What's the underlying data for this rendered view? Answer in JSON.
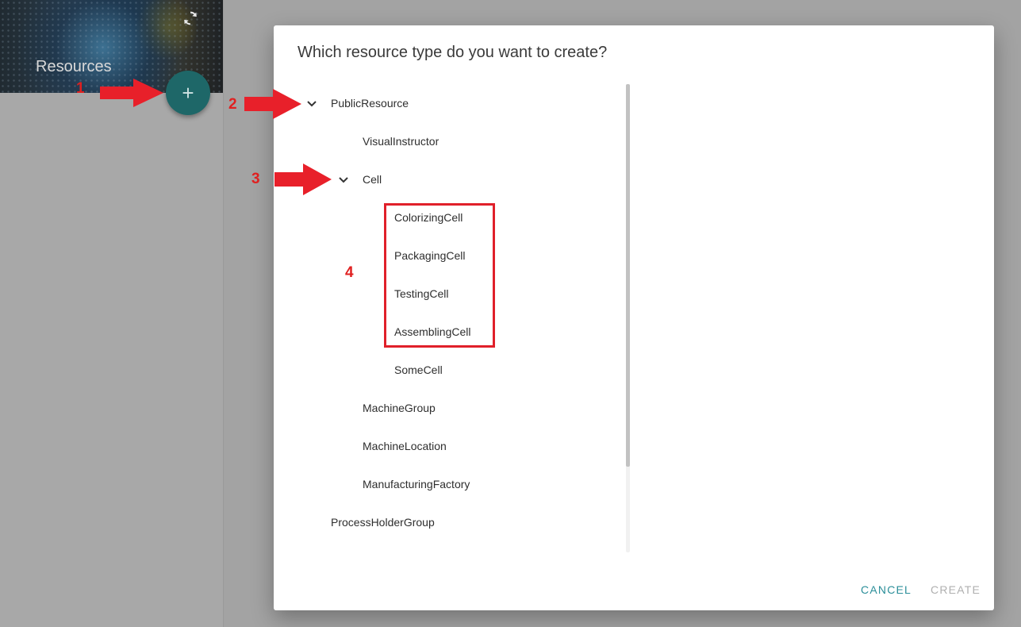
{
  "sidebar": {
    "title": "Resources",
    "fab_label": "+",
    "refresh_icon": "refresh-icon",
    "add_icon": "plus-icon"
  },
  "dialog": {
    "title": "Which resource type do you want to create?",
    "tree": [
      {
        "label": "PublicResource",
        "expanded": true
      },
      {
        "label": "VisualInstructor"
      },
      {
        "label": "Cell",
        "expanded": true
      },
      {
        "label": "ColorizingCell"
      },
      {
        "label": "PackagingCell"
      },
      {
        "label": "TestingCell"
      },
      {
        "label": "AssemblingCell"
      },
      {
        "label": "SomeCell"
      },
      {
        "label": "MachineGroup"
      },
      {
        "label": "MachineLocation"
      },
      {
        "label": "ManufacturingFactory"
      },
      {
        "label": "ProcessHolderGroup"
      }
    ],
    "actions": {
      "cancel_label": "CANCEL",
      "create_label": "CREATE",
      "create_enabled": false
    }
  },
  "annotations": {
    "labels": [
      "1",
      "2",
      "3",
      "4"
    ],
    "color": "#e02020"
  },
  "colors": {
    "fab": "#1e6768",
    "accent": "#2c8f9a",
    "disabled": "#b0b0b0"
  }
}
